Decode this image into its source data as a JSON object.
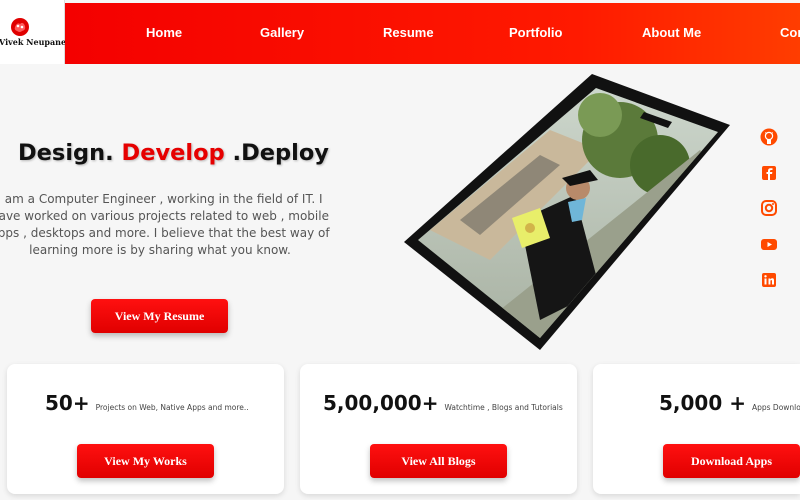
{
  "brand": {
    "logo_text": "Vivek Neupane"
  },
  "nav": {
    "items": [
      "Home",
      "Gallery",
      "Resume",
      "Portfolio",
      "About Me",
      "Contact"
    ]
  },
  "hero": {
    "headline_part1": "Design.",
    "headline_accent": " Develop",
    "headline_part2": " .Deploy",
    "intro": "I am a Computer Engineer , working in the field of IT. I have worked on various projects related to web , mobile apps , desktops and more. I believe that the best way of learning more is by sharing what you know.",
    "resume_button": "View My Resume"
  },
  "social": [
    "github-icon",
    "facebook-icon",
    "instagram-icon",
    "youtube-icon",
    "linkedin-icon"
  ],
  "stats": [
    {
      "number": "50+",
      "description": "Projects on Web, Native Apps and more..",
      "button": "View My Works"
    },
    {
      "number": "5,00,000+",
      "description": "Watchtime , Blogs and Tutorials",
      "button": "View All Blogs"
    },
    {
      "number": "5,000 +",
      "description": "Apps Downloads",
      "button": "Download Apps"
    }
  ],
  "colors": {
    "accent": "#e60000",
    "nav_gradient_start": "#f40000",
    "nav_gradient_end": "#ff3d00",
    "social_icon": "#ff4a00"
  }
}
